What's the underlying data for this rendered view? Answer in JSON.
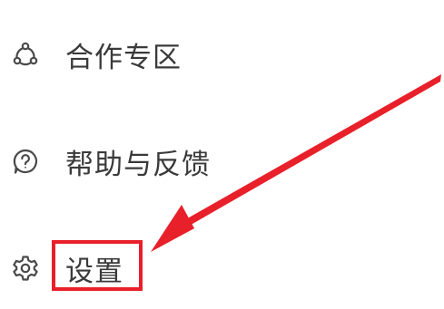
{
  "menu": {
    "items": [
      {
        "label": "合作专区",
        "icon": "cooperation-icon"
      },
      {
        "label": "帮助与反馈",
        "icon": "help-feedback-icon"
      },
      {
        "label": "设置",
        "icon": "gear-icon"
      }
    ]
  },
  "annotation": {
    "highlight_target": "设置",
    "highlight_color": "#e8202a",
    "arrow_color": "#e8202a"
  },
  "colors": {
    "background": "#ffffff",
    "text": "#3a3a3a",
    "icon": "#4a4a4a"
  }
}
